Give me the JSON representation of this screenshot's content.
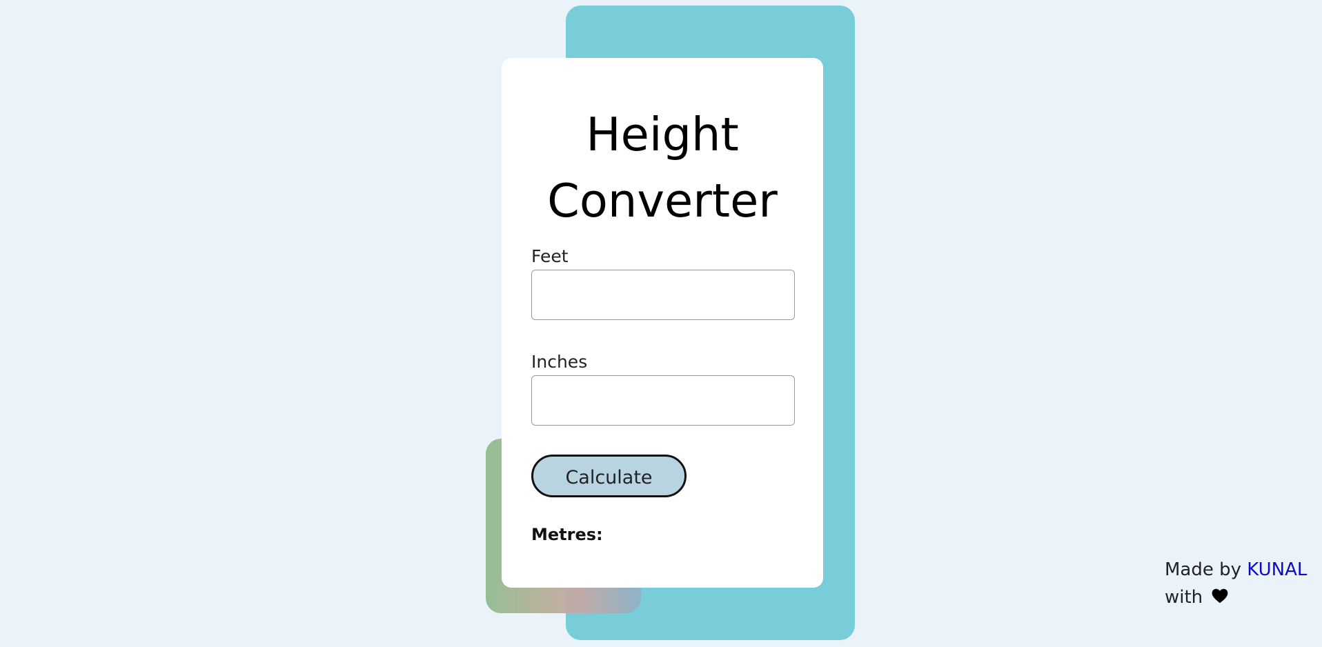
{
  "converter": {
    "title_line1": "Height",
    "title_line2": "Converter",
    "feet_label": "Feet",
    "feet_value": "",
    "inches_label": "Inches",
    "inches_value": "",
    "calculate_label": "Calculate",
    "result_label": "Metres:",
    "result_value": ""
  },
  "footer": {
    "made_by": "Made by",
    "author": "KUNAL",
    "with": "with",
    "heart_icon": "heart-icon"
  },
  "colors": {
    "page_background": "#eaf2fa",
    "backdrop_blue": "#78cdd9",
    "button_fill": "#b8d4e0",
    "author_link": "#0c0cc8"
  }
}
